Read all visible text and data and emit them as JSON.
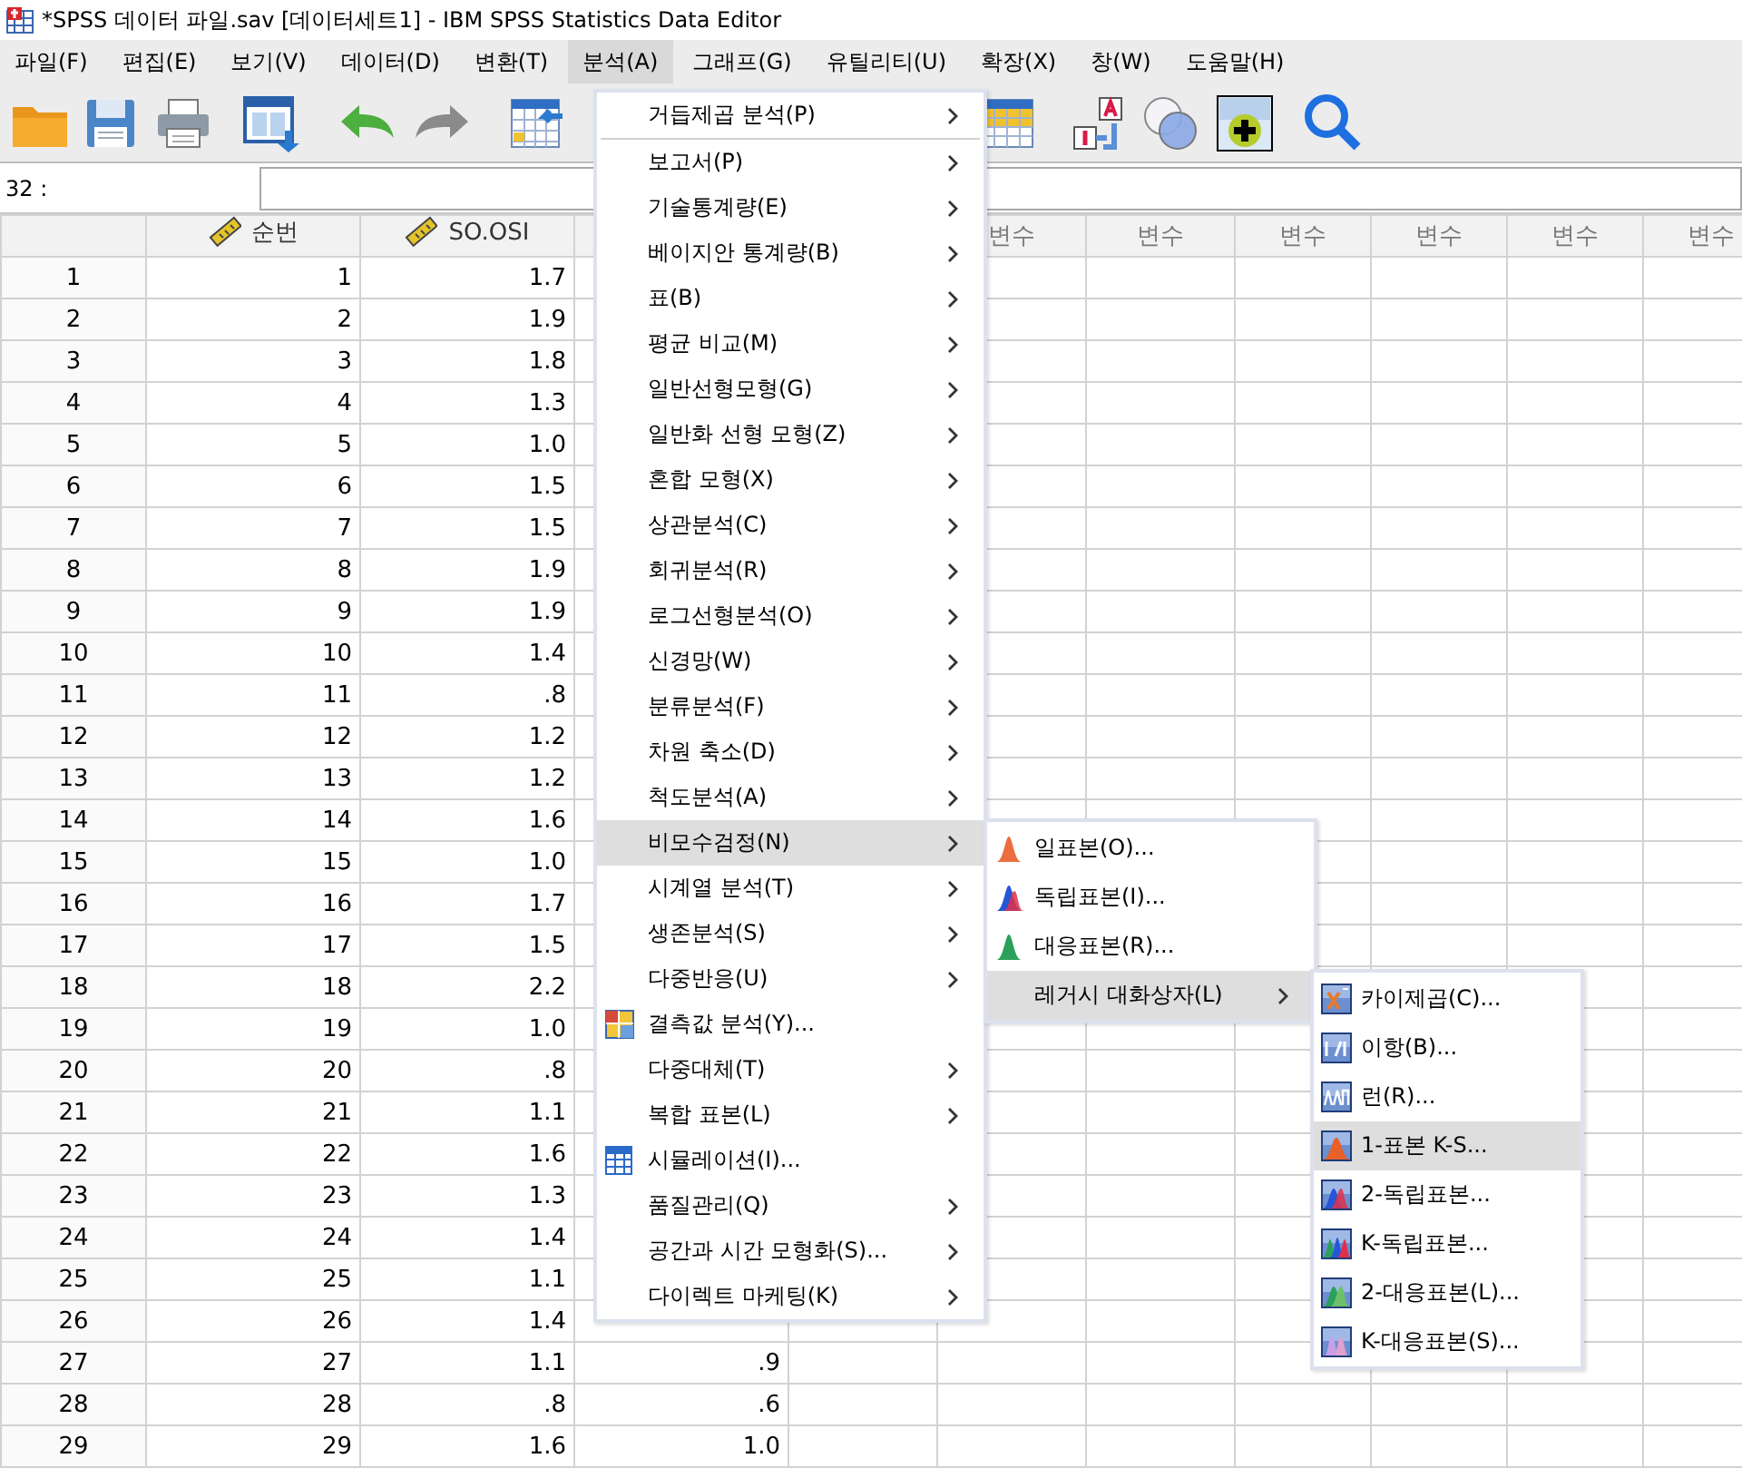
{
  "window": {
    "title": "*SPSS 데이터 파일.sav [데이터세트1] - IBM SPSS Statistics Data Editor"
  },
  "menu_bar": [
    {
      "label": "파일(F)",
      "selected": false
    },
    {
      "label": "편집(E)",
      "selected": false
    },
    {
      "label": "보기(V)",
      "selected": false
    },
    {
      "label": "데이터(D)",
      "selected": false
    },
    {
      "label": "변환(T)",
      "selected": false
    },
    {
      "label": "분석(A)",
      "selected": true
    },
    {
      "label": "그래프(G)",
      "selected": false
    },
    {
      "label": "유틸리티(U)",
      "selected": false
    },
    {
      "label": "확장(X)",
      "selected": false
    },
    {
      "label": "창(W)",
      "selected": false
    },
    {
      "label": "도움말(H)",
      "selected": false
    }
  ],
  "cell_editor": {
    "cell_reference": "32 :"
  },
  "grid": {
    "columns": [
      {
        "label": "순번",
        "scale_measure": true
      },
      {
        "label": "SO.OSI",
        "scale_measure": true
      }
    ],
    "variable_columns": [
      {
        "label": "변수"
      },
      {
        "label": "변수"
      },
      {
        "label": "변수"
      },
      {
        "label": "변수"
      },
      {
        "label": "변수"
      },
      {
        "label": "변수"
      }
    ],
    "rows": [
      {
        "number": "1",
        "cells": [
          "1",
          "1.7"
        ]
      },
      {
        "number": "2",
        "cells": [
          "2",
          "1.9"
        ]
      },
      {
        "number": "3",
        "cells": [
          "3",
          "1.8"
        ]
      },
      {
        "number": "4",
        "cells": [
          "4",
          "1.3"
        ]
      },
      {
        "number": "5",
        "cells": [
          "5",
          "1.0"
        ]
      },
      {
        "number": "6",
        "cells": [
          "6",
          "1.5"
        ]
      },
      {
        "number": "7",
        "cells": [
          "7",
          "1.5"
        ]
      },
      {
        "number": "8",
        "cells": [
          "8",
          "1.9"
        ]
      },
      {
        "number": "9",
        "cells": [
          "9",
          "1.9"
        ]
      },
      {
        "number": "10",
        "cells": [
          "10",
          "1.4"
        ]
      },
      {
        "number": "11",
        "cells": [
          "11",
          ".8"
        ]
      },
      {
        "number": "12",
        "cells": [
          "12",
          "1.2"
        ]
      },
      {
        "number": "13",
        "cells": [
          "13",
          "1.2"
        ]
      },
      {
        "number": "14",
        "cells": [
          "14",
          "1.6"
        ]
      },
      {
        "number": "15",
        "cells": [
          "15",
          "1.0"
        ]
      },
      {
        "number": "16",
        "cells": [
          "16",
          "1.7"
        ]
      },
      {
        "number": "17",
        "cells": [
          "17",
          "1.5"
        ]
      },
      {
        "number": "18",
        "cells": [
          "18",
          "2.2"
        ]
      },
      {
        "number": "19",
        "cells": [
          "19",
          "1.0"
        ]
      },
      {
        "number": "20",
        "cells": [
          "20",
          ".8"
        ]
      },
      {
        "number": "21",
        "cells": [
          "21",
          "1.1"
        ]
      },
      {
        "number": "22",
        "cells": [
          "22",
          "1.6"
        ]
      },
      {
        "number": "23",
        "cells": [
          "23",
          "1.3"
        ]
      },
      {
        "number": "24",
        "cells": [
          "24",
          "1.4"
        ]
      },
      {
        "number": "25",
        "cells": [
          "25",
          "1.1"
        ]
      },
      {
        "number": "26",
        "cells": [
          "26",
          "1.4"
        ]
      },
      {
        "number": "27",
        "cells": [
          "27",
          "1.1",
          ".9"
        ]
      },
      {
        "number": "28",
        "cells": [
          "28",
          ".8",
          ".6"
        ]
      },
      {
        "number": "29",
        "cells": [
          "29",
          "1.6",
          "1.0"
        ]
      }
    ]
  },
  "analyze_menu": {
    "items": [
      {
        "kind": "submenu",
        "label": "거듭제곱 분석(P)",
        "selected": false
      },
      {
        "kind": "separator"
      },
      {
        "kind": "submenu",
        "label": "보고서(P)",
        "selected": false
      },
      {
        "kind": "submenu",
        "label": "기술통계량(E)",
        "selected": false
      },
      {
        "kind": "submenu",
        "label": "베이지안 통계량(B)",
        "selected": false
      },
      {
        "kind": "submenu",
        "label": "표(B)",
        "selected": false
      },
      {
        "kind": "submenu",
        "label": "평균 비교(M)",
        "selected": false
      },
      {
        "kind": "submenu",
        "label": "일반선형모형(G)",
        "selected": false
      },
      {
        "kind": "submenu",
        "label": "일반화 선형 모형(Z)",
        "selected": false
      },
      {
        "kind": "submenu",
        "label": "혼합 모형(X)",
        "selected": false
      },
      {
        "kind": "submenu",
        "label": "상관분석(C)",
        "selected": false
      },
      {
        "kind": "submenu",
        "label": "회귀분석(R)",
        "selected": false
      },
      {
        "kind": "submenu",
        "label": "로그선형분석(O)",
        "selected": false
      },
      {
        "kind": "submenu",
        "label": "신경망(W)",
        "selected": false
      },
      {
        "kind": "submenu",
        "label": "분류분석(F)",
        "selected": false
      },
      {
        "kind": "submenu",
        "label": "차원 축소(D)",
        "selected": false
      },
      {
        "kind": "submenu",
        "label": "척도분석(A)",
        "selected": false
      },
      {
        "kind": "submenu",
        "label": "비모수검정(N)",
        "selected": true
      },
      {
        "kind": "submenu",
        "label": "시계열 분석(T)",
        "selected": false
      },
      {
        "kind": "submenu",
        "label": "생존분석(S)",
        "selected": false
      },
      {
        "kind": "submenu",
        "label": "다중반응(U)",
        "selected": false
      },
      {
        "kind": "dialog",
        "label": "결측값 분석(Y)...",
        "selected": false
      },
      {
        "kind": "submenu",
        "label": "다중대체(T)",
        "selected": false
      },
      {
        "kind": "submenu",
        "label": "복합 표본(L)",
        "selected": false
      },
      {
        "kind": "dialog",
        "label": "시뮬레이션(I)...",
        "selected": false
      },
      {
        "kind": "submenu",
        "label": "품질관리(Q)",
        "selected": false
      },
      {
        "kind": "submenu",
        "label": "공간과 시간 모형화(S)...",
        "selected": false
      },
      {
        "kind": "submenu",
        "label": "다이렉트 마케팅(K)",
        "selected": false
      }
    ]
  },
  "nonparametric_menu": {
    "items": [
      {
        "kind": "dialog",
        "label": "일표본(O)...",
        "selected": false
      },
      {
        "kind": "dialog",
        "label": "독립표본(I)...",
        "selected": false
      },
      {
        "kind": "dialog",
        "label": "대응표본(R)...",
        "selected": false
      },
      {
        "kind": "submenu",
        "label": "레거시 대화상자(L)",
        "selected": true
      }
    ]
  },
  "legacy_menu": {
    "items": [
      {
        "kind": "dialog",
        "label": "카이제곱(C)...",
        "selected": false
      },
      {
        "kind": "dialog",
        "label": "이항(B)...",
        "selected": false
      },
      {
        "kind": "dialog",
        "label": "런(R)...",
        "selected": false
      },
      {
        "kind": "dialog",
        "label": "1-표본 K-S...",
        "selected": true
      },
      {
        "kind": "dialog",
        "label": "2-독립표본...",
        "selected": false
      },
      {
        "kind": "dialog",
        "label": "K-독립표본...",
        "selected": false
      },
      {
        "kind": "dialog",
        "label": "2-대응표본(L)...",
        "selected": false
      },
      {
        "kind": "dialog",
        "label": "K-대응표본(S)...",
        "selected": false
      }
    ]
  }
}
